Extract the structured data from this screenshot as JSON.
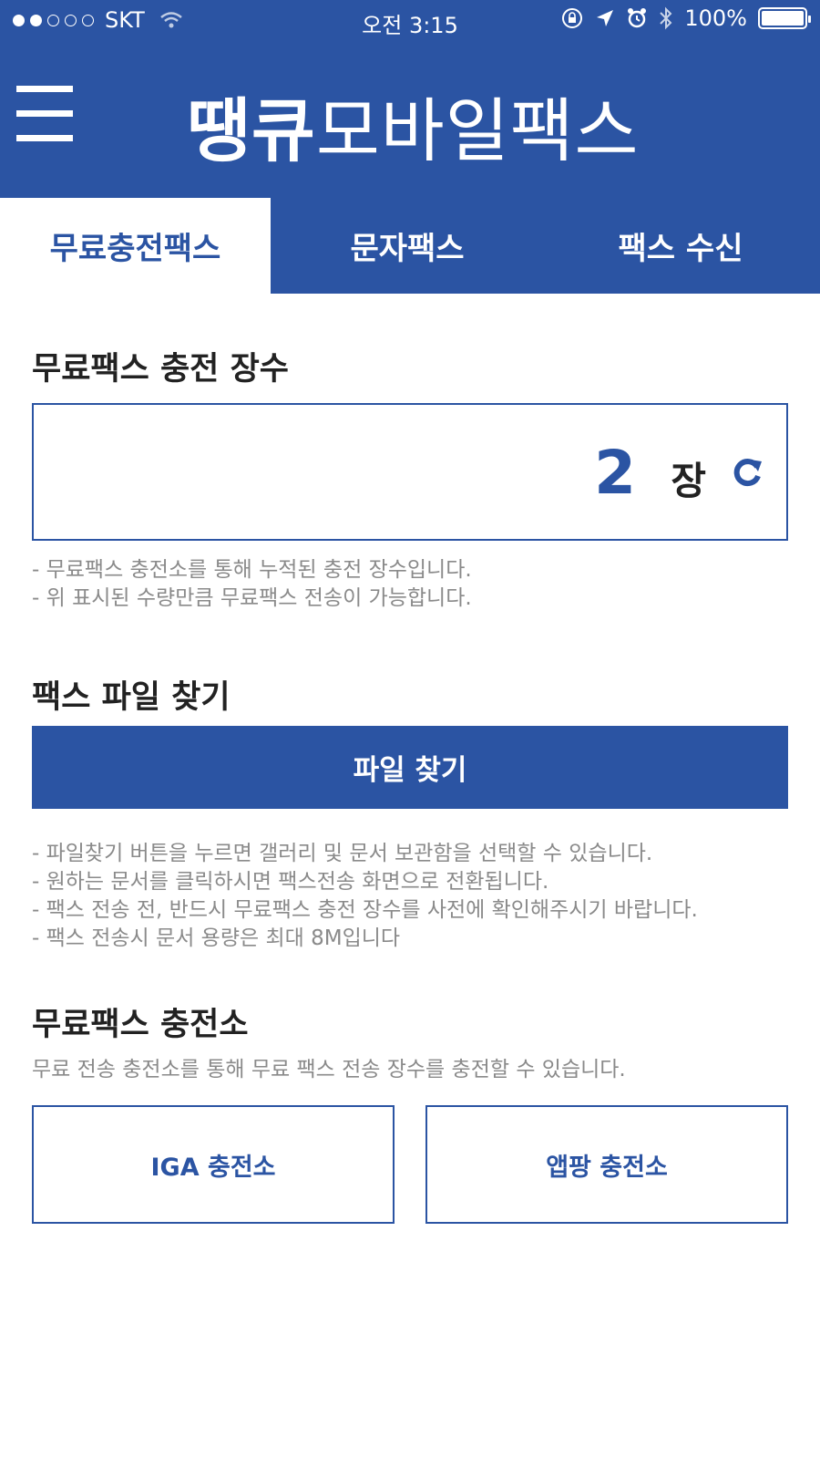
{
  "status_bar": {
    "carrier": "SKT",
    "time": "오전 3:15",
    "battery": "100%"
  },
  "header": {
    "title_bold": "땡큐",
    "title_light": "모바일팩스"
  },
  "tabs": [
    {
      "label": "무료충전팩스",
      "active": true
    },
    {
      "label": "문자팩스",
      "active": false
    },
    {
      "label": "팩스 수신",
      "active": false
    }
  ],
  "count_section": {
    "title": "무료팩스 충전 장수",
    "count": "2",
    "unit": "장",
    "notes": [
      "- 무료팩스 충전소를 통해 누적된 충전 장수입니다.",
      "- 위 표시된 수량만큼 무료팩스 전송이 가능합니다."
    ]
  },
  "file_section": {
    "title": "팩스 파일 찾기",
    "button_label": "파일 찾기",
    "notes": [
      "- 파일찾기 버튼을 누르면 갤러리 및 문서 보관함을 선택할 수 있습니다.",
      "- 원하는 문서를 클릭하시면 팩스전송 화면으로 전환됩니다.",
      "- 팩스 전송 전, 반드시 무료팩스 충전 장수를 사전에 확인해주시기 바랍니다.",
      "- 팩스 전송시 문서 용량은 최대 8M입니다"
    ]
  },
  "station_section": {
    "title": "무료팩스 충전소",
    "description": "무료 전송 충전소를 통해 무료 팩스 전송 장수를 충전할 수 있습니다.",
    "buttons": [
      "IGA 충전소",
      "앱팡 충전소"
    ]
  },
  "colors": {
    "brand_blue": "#2b54a3",
    "note_gray": "#8a8a8a"
  }
}
